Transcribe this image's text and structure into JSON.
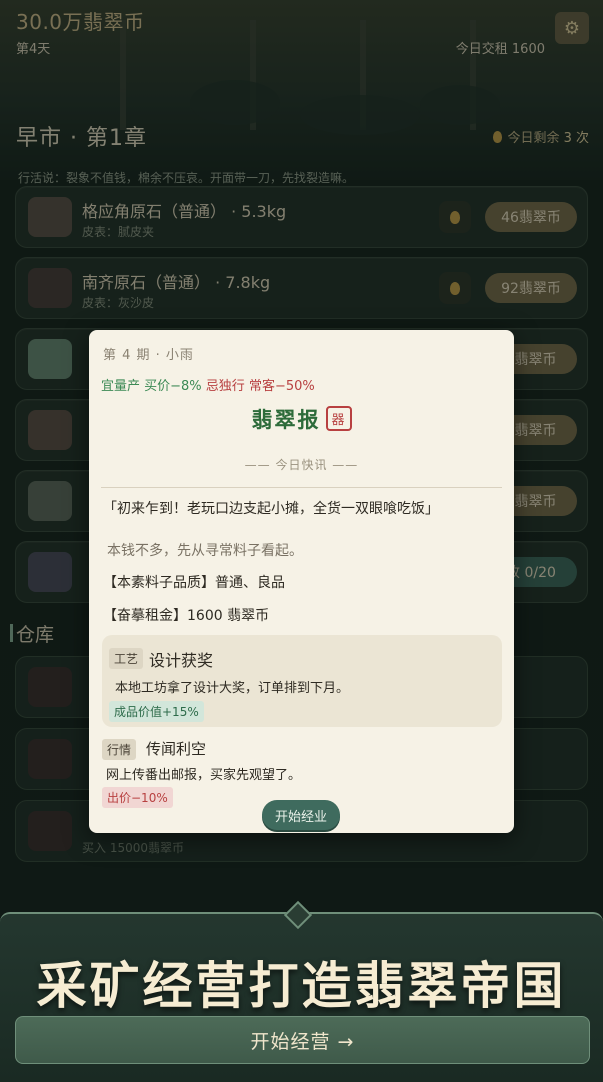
{
  "topbar": {
    "money": "30.0万翡翠币",
    "day": "第4天",
    "rent": "今日交租 1600",
    "settings_icon": "gear-icon"
  },
  "market": {
    "title": "早市 · 第1章",
    "today_left_label": "今日剩余",
    "today_left_count": "3 次",
    "saying": "行活说：裂象不值钱，棉余不压哀。开面带一刀，先找裂造嘛。"
  },
  "stones": [
    {
      "name": "格应角原石（普通） · 5.3kg",
      "skin": "皮表：腻皮夹",
      "price": "46翡翠币",
      "thumb_color": "#5c5147"
    },
    {
      "name": "南齐原石（普通） · 7.8kg",
      "skin": "皮表：灰沙皮",
      "price": "92翡翠币",
      "thumb_color": "#4a3d3a"
    },
    {
      "name": "",
      "skin": "",
      "price": "8翡翠币",
      "thumb_color": "#6b8b76"
    },
    {
      "name": "",
      "skin": "",
      "price": "2翡翠币",
      "thumb_color": "#5e4f46"
    },
    {
      "name": "",
      "skin": "",
      "price": "8翡翠币",
      "thumb_color": "#5f6b5d"
    },
    {
      "name": "",
      "skin": "",
      "price": "收 0/20",
      "thumb_color": "#4c4c5c"
    }
  ],
  "warehouse": {
    "title": "仓库",
    "items": [
      {
        "sub": ""
      },
      {
        "sub": ""
      },
      {
        "sub": "买入 15000翡翠币"
      }
    ]
  },
  "newspaper": {
    "issue": "第 4 期 · 小雨",
    "effects": [
      {
        "text": "宜量产 ",
        "kind": "good"
      },
      {
        "text": "买价−8% ",
        "kind": "good"
      },
      {
        "text": "忌独行 ",
        "kind": "bad"
      },
      {
        "text": "常客−50%",
        "kind": "bad"
      }
    ],
    "title": "翡翠报",
    "title_badge": "器",
    "section": "—— 今日快讯 ——",
    "headline": "「初来乍到！老玩口边支起小摊，全货一双眼喰吃饭」",
    "line1": "本钱不多，先从寻常料子看起。",
    "line2": "【本素料子品质】普通、良品",
    "line3": "【奋摹租金】1600 翡翠币",
    "news": [
      {
        "tag": "工艺",
        "title": "设计获奖",
        "body": "本地工坊拿了设计大奖，订单排到下月。",
        "effect": "成品价值+15%"
      },
      {
        "tag": "行情",
        "title": "传闻利空",
        "body": "网上传番出邮报，买家先观望了。",
        "effect": "出价−10%"
      }
    ],
    "start_button": "开始经业"
  },
  "footer": {
    "slogan": "采矿经营打造翡翠帝国",
    "start_button": "开始经营 →"
  }
}
